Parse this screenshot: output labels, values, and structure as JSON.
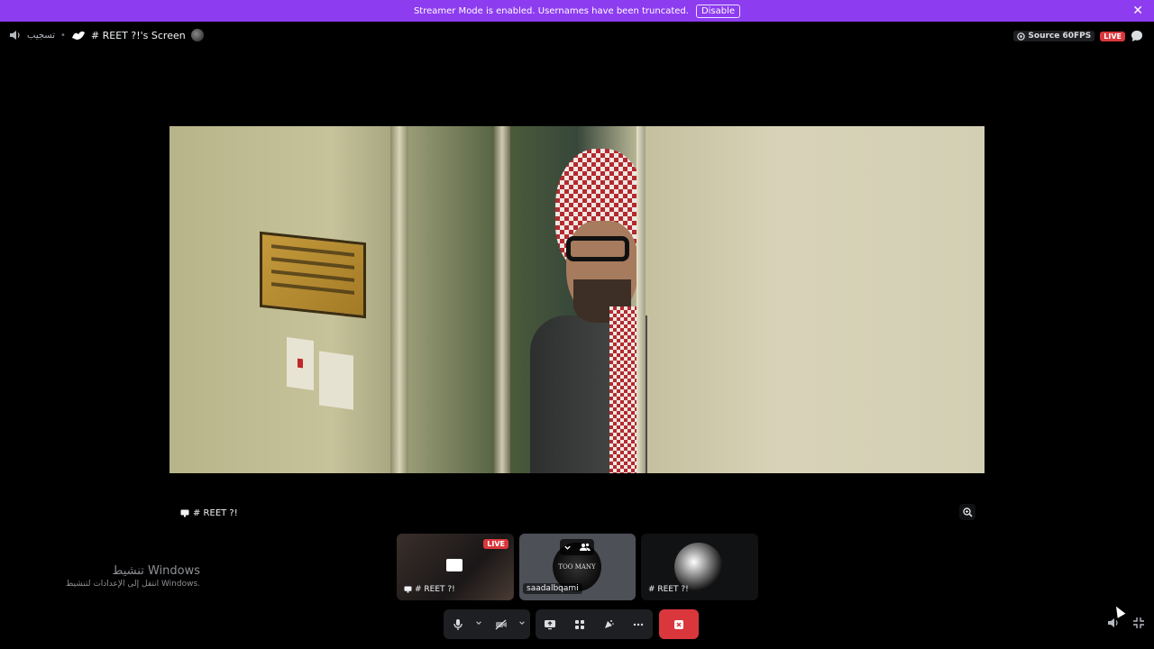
{
  "banner": {
    "message": "Streamer Mode is enabled. Usernames have been truncated.",
    "disable_label": "Disable",
    "close_glyph": "✕",
    "color": "#8d3cf0"
  },
  "topbar": {
    "channel_arabic": "تسجيب",
    "separator": "•",
    "title": "# REET ?!'s Screen",
    "quality": "Source 60FPS",
    "live_label": "LIVE"
  },
  "stream": {
    "name": "# REET ?!"
  },
  "watermark": {
    "line1": "تنشيط Windows",
    "line2": "انتقل إلى الإعدادات لتنشيط Windows."
  },
  "tiles": [
    {
      "label": "# REET ?!",
      "live": "LIVE",
      "type": "screen-share"
    },
    {
      "label": "saadalbqami",
      "avatar_text": "TOO MANY",
      "type": "user"
    },
    {
      "label": "# REET ?!",
      "type": "user"
    }
  ],
  "controls": {
    "icons": [
      "microphone-icon",
      "camera-off-icon",
      "screen-share-icon",
      "activities-icon",
      "soundboard-icon",
      "more-icon",
      "disconnect-icon"
    ],
    "end_color": "#da373c"
  }
}
